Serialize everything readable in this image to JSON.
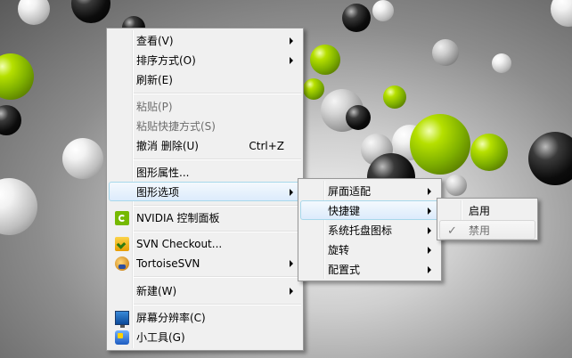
{
  "main_menu": {
    "items": [
      {
        "label": "查看(V)",
        "submenu": true
      },
      {
        "label": "排序方式(O)",
        "submenu": true
      },
      {
        "label": "刷新(E)"
      },
      {
        "label": "粘贴(P)",
        "disabled": true
      },
      {
        "label": "粘贴快捷方式(S)",
        "disabled": true
      },
      {
        "label": "撤消 删除(U)",
        "shortcut": "Ctrl+Z"
      },
      {
        "label": "图形属性..."
      },
      {
        "label": "图形选项",
        "submenu": true,
        "highlighted": true
      },
      {
        "label": "NVIDIA 控制面板",
        "icon": "nvidia-icon"
      },
      {
        "label": "SVN Checkout...",
        "icon": "svn-checkout-icon"
      },
      {
        "label": "TortoiseSVN",
        "icon": "tortoisesvn-icon",
        "submenu": true
      },
      {
        "label": "新建(W)",
        "submenu": true
      },
      {
        "label": "屏幕分辨率(C)",
        "icon": "screen-resolution-icon"
      },
      {
        "label": "小工具(G)",
        "icon": "gadgets-icon"
      }
    ]
  },
  "graphics_options_menu": {
    "items": [
      {
        "label": "屏面适配",
        "submenu": true
      },
      {
        "label": "快捷键",
        "submenu": true,
        "highlighted": true
      },
      {
        "label": "系统托盘图标",
        "submenu": true
      },
      {
        "label": "旋转",
        "submenu": true
      },
      {
        "label": "配置式",
        "submenu": true
      }
    ]
  },
  "hotkeys_menu": {
    "items": [
      {
        "label": "启用"
      },
      {
        "label": "禁用",
        "checked": true,
        "disabled": true
      }
    ]
  },
  "colors": {
    "menu_bg": "#f0f0f0",
    "highlight_border": "#a8d8eb",
    "disabled_text": "#6d6d6d"
  }
}
